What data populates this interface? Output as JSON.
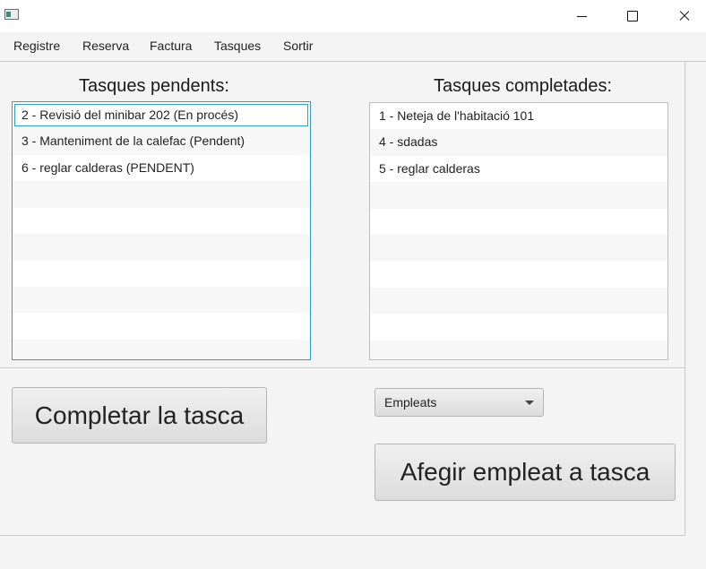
{
  "menu": {
    "items": [
      "Registre",
      "Reserva",
      "Factura",
      "Tasques",
      "Sortir"
    ]
  },
  "pending": {
    "title": "Tasques pendents:",
    "items": [
      "2 - Revisió del minibar 202 (En procés)",
      "3 - Manteniment de la calefac (Pendent)",
      "6 - reglar calderas (PENDENT)"
    ]
  },
  "completed": {
    "title": "Tasques completades:",
    "items": [
      "1 - Neteja de l'habitació 101",
      "4 - sdadas",
      "5 - reglar calderas"
    ]
  },
  "actions": {
    "complete_label": "Completar la tasca",
    "employees_combo": "Empleats",
    "add_employee_label": "Afegir empleat a tasca"
  },
  "colors": {
    "focus_accent": "#2ba1c9"
  }
}
